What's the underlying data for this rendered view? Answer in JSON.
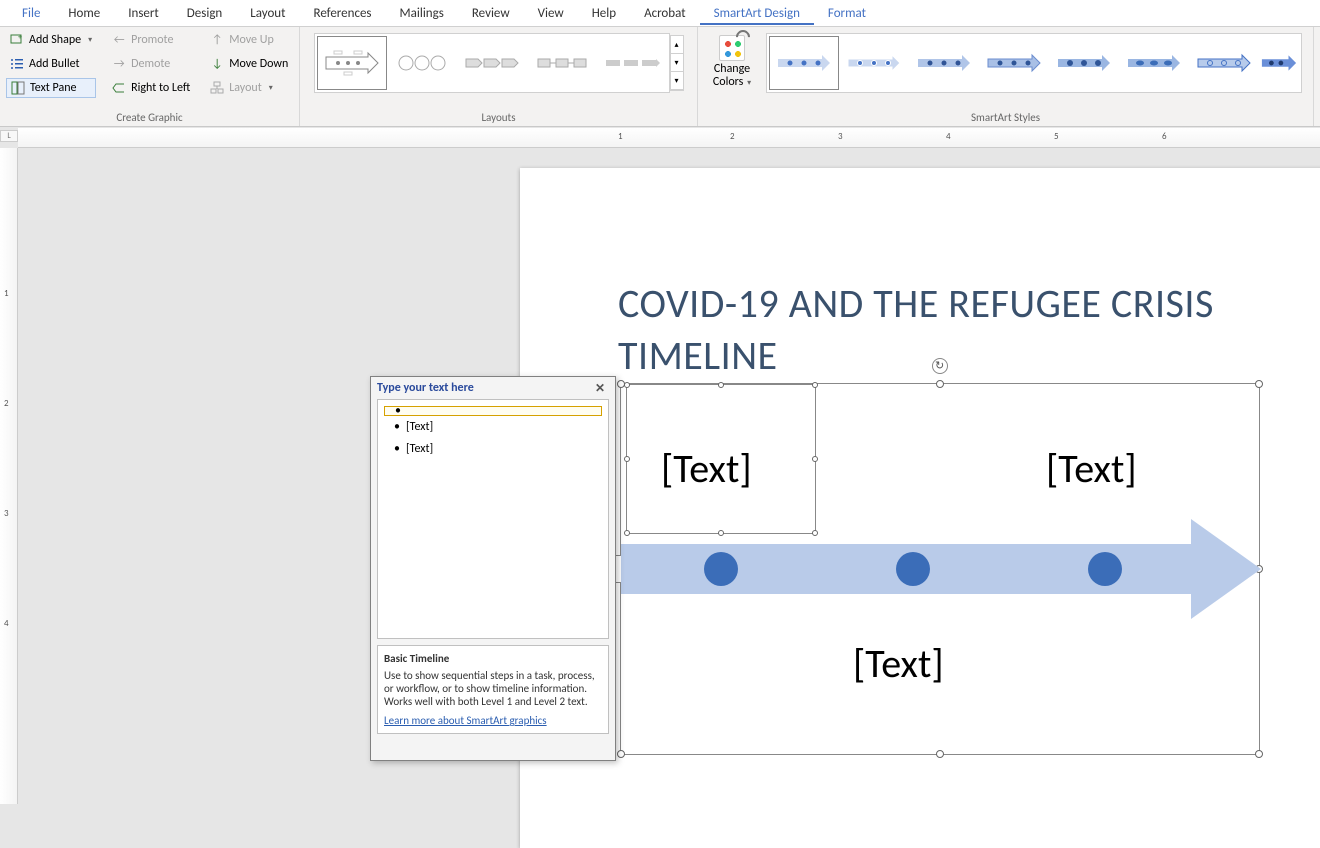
{
  "tabs": [
    "File",
    "Home",
    "Insert",
    "Design",
    "Layout",
    "References",
    "Mailings",
    "Review",
    "View",
    "Help",
    "Acrobat",
    "SmartArt Design",
    "Format"
  ],
  "active_tab": "SmartArt Design",
  "ribbon": {
    "create_graphic": {
      "label": "Create Graphic",
      "add_shape": "Add Shape",
      "add_bullet": "Add Bullet",
      "text_pane": "Text Pane",
      "promote": "Promote",
      "demote": "Demote",
      "right_to_left": "Right to Left",
      "move_up": "Move Up",
      "move_down": "Move Down",
      "layout": "Layout"
    },
    "layouts": {
      "label": "Layouts"
    },
    "change_colors": "Change Colors",
    "styles": {
      "label": "SmartArt Styles"
    }
  },
  "ruler": {
    "corner": "L",
    "h_numbers": [
      1,
      2,
      3,
      4,
      5,
      6
    ],
    "v_numbers": [
      1,
      2,
      3,
      4
    ]
  },
  "document": {
    "title": "COVID-19 AND THE REFUGEE CRISIS TIMELINE",
    "placeholders": {
      "p1": "[Text]",
      "p2": "[Text]",
      "p3": "[Text]"
    }
  },
  "textpane": {
    "title": "Type your text here",
    "items": [
      "",
      "[Text]",
      "[Text]"
    ],
    "footer_title": "Basic Timeline",
    "footer_desc": "Use to show sequential steps in a task, process, or workflow, or to show timeline information. Works well with both Level 1 and Level 2 text.",
    "footer_link": "Learn more about SmartArt graphics"
  }
}
